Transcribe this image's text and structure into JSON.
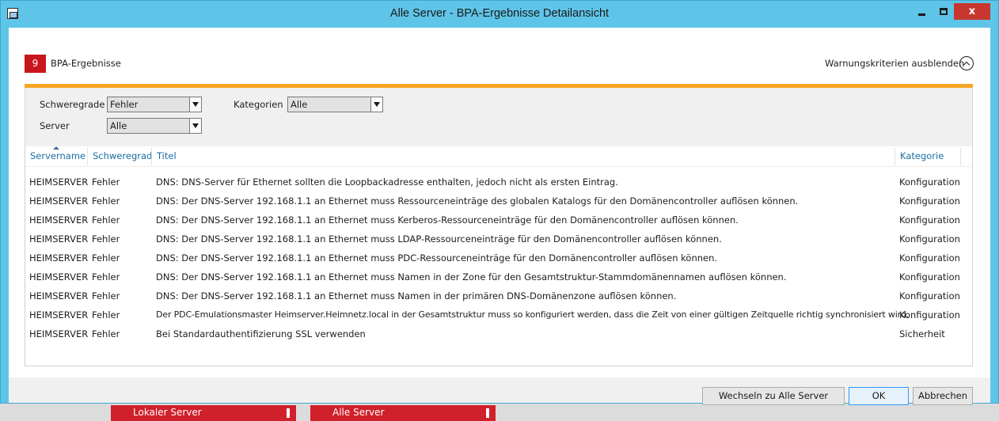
{
  "window": {
    "title": "Alle Server - BPA-Ergebnisse Detailansicht",
    "close_glyph": "x"
  },
  "summary": {
    "count": "9",
    "label": "BPA-Ergebnisse",
    "hide_criteria": "Warnungskriterien ausblenden"
  },
  "filters": {
    "severity_label": "Schweregrade",
    "severity_value": "Fehler",
    "server_label": "Server",
    "server_value": "Alle",
    "category_label": "Kategorien",
    "category_value": "Alle"
  },
  "table": {
    "columns": [
      "Servername",
      "Schweregrad",
      "Titel",
      "Kategorie"
    ],
    "rows": [
      {
        "server": "HEIMSERVER",
        "severity": "Fehler",
        "title": "DNS: DNS-Server für Ethernet sollten die Loopbackadresse enthalten, jedoch nicht als ersten Eintrag.",
        "category": "Konfiguration"
      },
      {
        "server": "HEIMSERVER",
        "severity": "Fehler",
        "title": "DNS: Der DNS-Server 192.168.1.1 an Ethernet muss Ressourceneinträge des globalen Katalogs für den Domänencontroller auflösen können.",
        "category": "Konfiguration"
      },
      {
        "server": "HEIMSERVER",
        "severity": "Fehler",
        "title": "DNS: Der DNS-Server 192.168.1.1 an Ethernet muss Kerberos-Ressourceneinträge für den Domänencontroller auflösen können.",
        "category": "Konfiguration"
      },
      {
        "server": "HEIMSERVER",
        "severity": "Fehler",
        "title": "DNS: Der DNS-Server 192.168.1.1 an Ethernet muss LDAP-Ressourceneinträge für den Domänencontroller auflösen können.",
        "category": "Konfiguration"
      },
      {
        "server": "HEIMSERVER",
        "severity": "Fehler",
        "title": "DNS: Der DNS-Server 192.168.1.1 an Ethernet muss PDC-Ressourceneinträge für den Domänencontroller auflösen können.",
        "category": "Konfiguration"
      },
      {
        "server": "HEIMSERVER",
        "severity": "Fehler",
        "title": "DNS: Der DNS-Server 192.168.1.1 an Ethernet muss Namen in der Zone für den Gesamtstruktur-Stammdomänennamen auflösen können.",
        "category": "Konfiguration"
      },
      {
        "server": "HEIMSERVER",
        "severity": "Fehler",
        "title": "DNS: Der DNS-Server 192.168.1.1 an Ethernet muss Namen in der primären DNS-Domänenzone auflösen können.",
        "category": "Konfiguration"
      },
      {
        "server": "HEIMSERVER",
        "severity": "Fehler",
        "title": "Der PDC-Emulationsmaster Heimserver.Heimnetz.local in der Gesamtstruktur muss so konfiguriert werden, dass die Zeit von einer gültigen Zeitquelle richtig synchronisiert wird.",
        "category": "Konfiguration"
      },
      {
        "server": "HEIMSERVER",
        "severity": "Fehler",
        "title": "Bei Standardauthentifizierung SSL verwenden",
        "category": "Sicherheit"
      }
    ]
  },
  "buttons": {
    "switch": "Wechseln zu Alle Server",
    "ok": "OK",
    "cancel": "Abbrechen"
  },
  "taskbar": {
    "item1": "Lokaler Server",
    "item2": "Alle Server"
  },
  "colors": {
    "window_frame": "#5fc5e8",
    "badge": "#c8161d",
    "accent_bar": "#f6a623",
    "header_text": "#1c6ea4",
    "close_button": "#c7372f"
  }
}
